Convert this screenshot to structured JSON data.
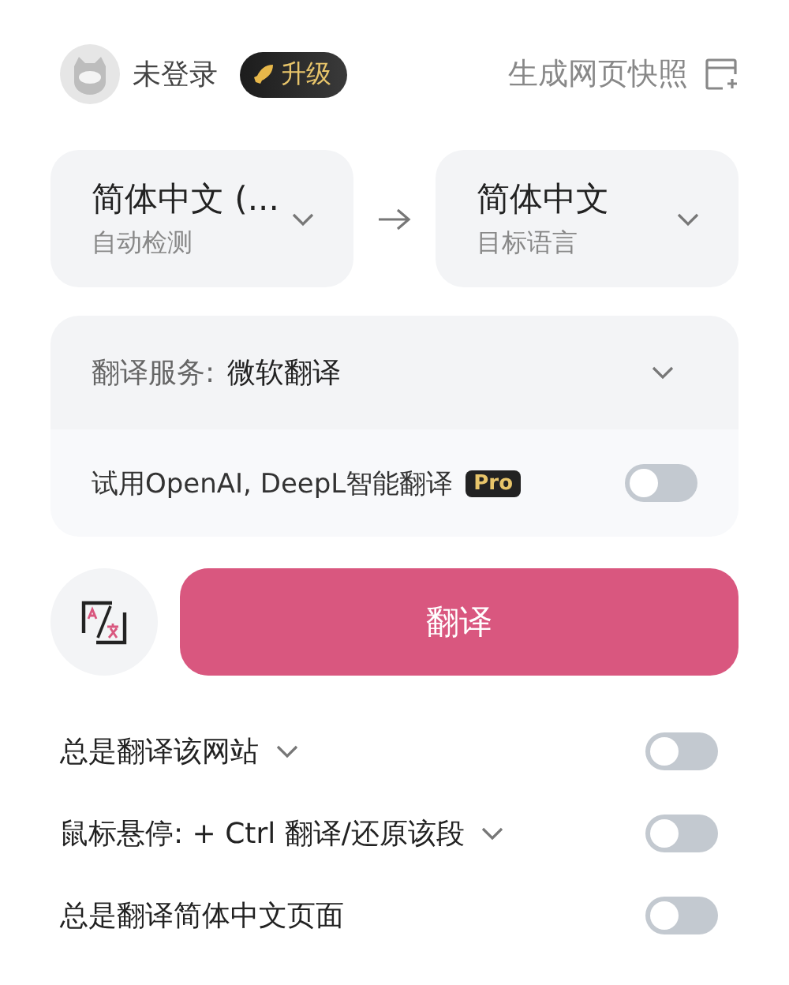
{
  "header": {
    "user": "未登录",
    "upgrade": "升级",
    "snapshot": "生成网页快照"
  },
  "languages": [
    {
      "name": "简体中文 (...",
      "caption": "自动检测"
    },
    {
      "name": "简体中文",
      "caption": "目标语言"
    }
  ],
  "service": {
    "label": "翻译服务:",
    "value": "微软翻译",
    "trial": "试用OpenAI, DeepL智能翻译",
    "badge": "Pro",
    "trial_on": false
  },
  "translate_button": "翻译",
  "options": [
    {
      "label": "总是翻译该网站",
      "dropdown": true,
      "on": false
    },
    {
      "label": "鼠标悬停: + Ctrl 翻译/还原该段",
      "dropdown": true,
      "on": false
    },
    {
      "label": "总是翻译简体中文页面",
      "dropdown": false,
      "on": false
    }
  ]
}
